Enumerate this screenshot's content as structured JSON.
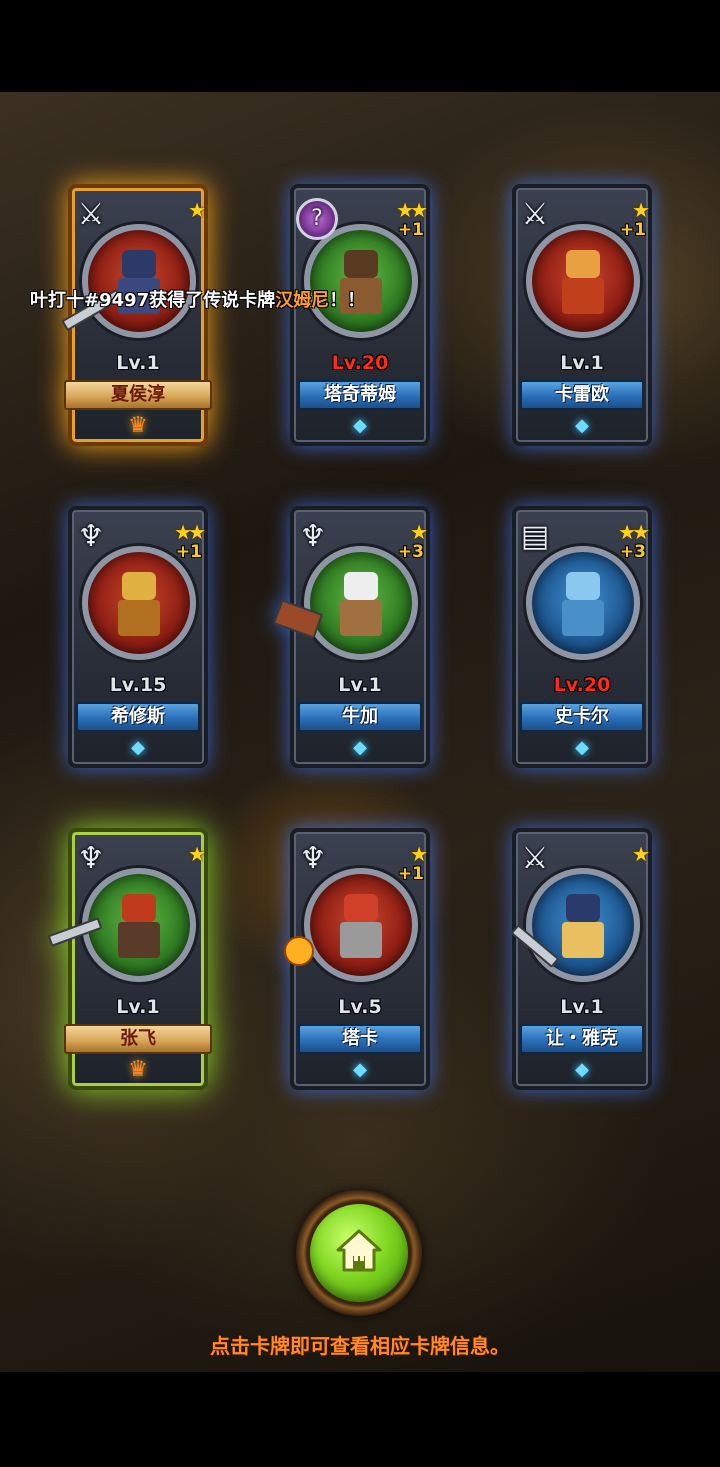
{
  "notification": {
    "prefix": "叶打十#9497获得了传说卡牌",
    "highlight": "汉姆尼",
    "suffix": "！！"
  },
  "cards": [
    {
      "name": "夏侯淳",
      "level": "Lv.1",
      "stars": "★",
      "plus": "",
      "emblem": "shield-swords-icon",
      "rarity": "legend-gold",
      "level_max": false
    },
    {
      "name": "塔奇蒂姆",
      "level": "Lv.20",
      "stars": "★★",
      "plus": "+1",
      "emblem": "magic-orb-icon",
      "rarity": "normal",
      "level_max": true
    },
    {
      "name": "卡雷欧",
      "level": "Lv.1",
      "stars": "★",
      "plus": "+1",
      "emblem": "shield-swords-icon",
      "rarity": "normal",
      "level_max": false
    },
    {
      "name": "希修斯",
      "level": "Lv.15",
      "stars": "★★",
      "plus": "+1",
      "emblem": "axe-icon",
      "rarity": "normal",
      "level_max": false
    },
    {
      "name": "牛加",
      "level": "Lv.1",
      "stars": "★",
      "plus": "+3",
      "emblem": "axe-icon",
      "rarity": "normal",
      "level_max": false
    },
    {
      "name": "史卡尔",
      "level": "Lv.20",
      "stars": "★★",
      "plus": "+3",
      "emblem": "spellbook-icon",
      "rarity": "normal",
      "level_max": true
    },
    {
      "name": "张飞",
      "level": "Lv.1",
      "stars": "★",
      "plus": "",
      "emblem": "axe-icon",
      "rarity": "legend-green",
      "level_max": false
    },
    {
      "name": "塔卡",
      "level": "Lv.5",
      "stars": "★",
      "plus": "+1",
      "emblem": "axe-icon",
      "rarity": "normal",
      "level_max": false
    },
    {
      "name": "让・雅克",
      "level": "Lv.1",
      "stars": "★",
      "plus": "",
      "emblem": "shield-swords-icon",
      "rarity": "normal",
      "level_max": false
    }
  ],
  "footer": {
    "hint": "点击卡牌即可查看相应卡牌信息。",
    "home_button": "home-icon"
  },
  "colors": {
    "legend_gold_glow": "#ffaa1e",
    "legend_green_glow": "#96e628",
    "rare_blue_glow": "#3c78ff",
    "max_level": "#ff2a1a",
    "hint_text": "#ff8a2a",
    "notice_highlight": "#ff9d28"
  }
}
